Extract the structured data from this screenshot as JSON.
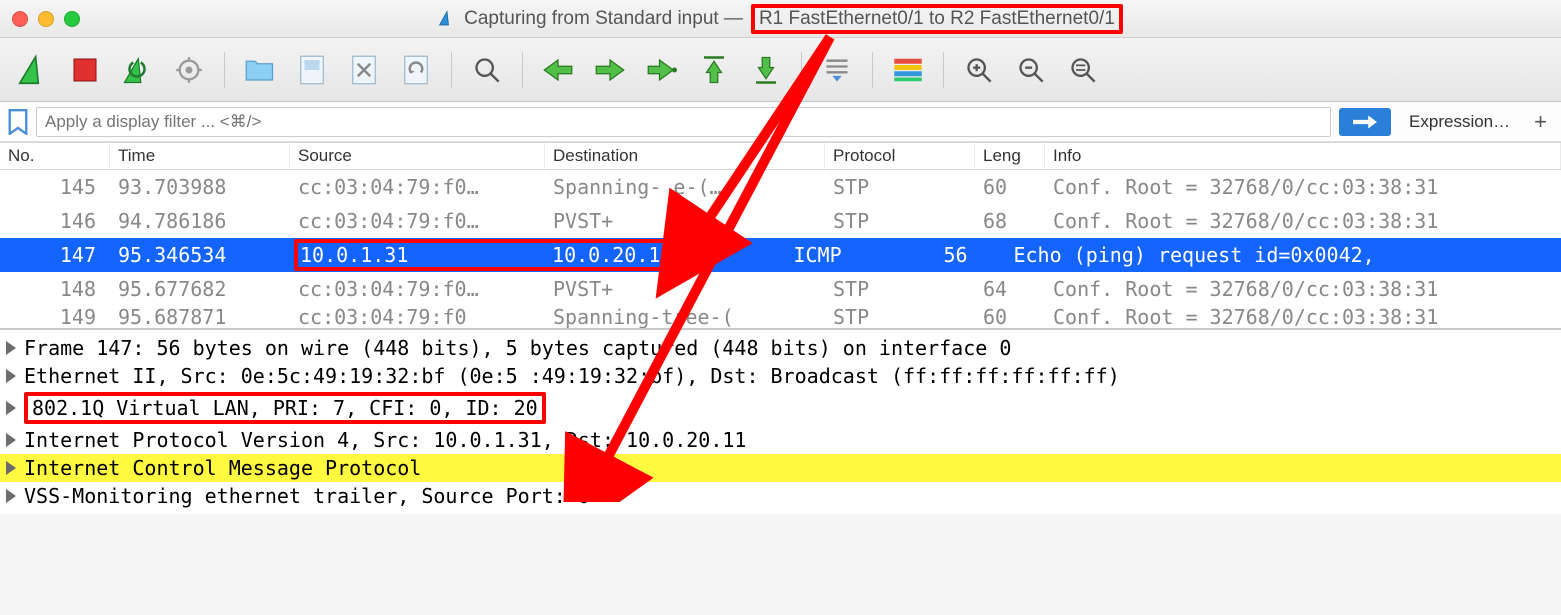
{
  "window": {
    "title_prefix": "Capturing from Standard input —",
    "title_highlight": "R1 FastEthernet0/1 to R2 FastEthernet0/1"
  },
  "filter": {
    "placeholder": "Apply a display filter ... <⌘/>",
    "expression_label": "Expression…"
  },
  "columns": {
    "no": "No.",
    "time": "Time",
    "source": "Source",
    "destination": "Destination",
    "protocol": "Protocol",
    "length": "Leng",
    "info": "Info"
  },
  "packets": [
    {
      "no": "145",
      "time": "93.703988",
      "src": "cc:03:04:79:f0…",
      "dst": "Spanning-    e-(…",
      "proto": "STP",
      "len": "60",
      "info": "Conf. Root = 32768/0/cc:03:38:31"
    },
    {
      "no": "146",
      "time": "94.786186",
      "src": "cc:03:04:79:f0…",
      "dst": "PVST+",
      "proto": "STP",
      "len": "68",
      "info": "Conf. Root = 32768/0/cc:03:38:31"
    },
    {
      "no": "147",
      "time": "95.346534",
      "src": "10.0.1.31",
      "dst": "10.0.20.11",
      "proto": "ICMP",
      "len": "56",
      "info": "Echo (ping) request  id=0x0042,"
    },
    {
      "no": "148",
      "time": "95.677682",
      "src": "cc:03:04:79:f0…",
      "dst": "PVST+",
      "proto": "STP",
      "len": "64",
      "info": "Conf. Root = 32768/0/cc:03:38:31"
    },
    {
      "no": "149",
      "time": "95.687871",
      "src": "cc:03:04:79:f0",
      "dst": "Spanning-tree-(",
      "proto": "STP",
      "len": "60",
      "info": "Conf. Root = 32768/0/cc:03:38:31"
    }
  ],
  "details": {
    "frame": "Frame 147: 56 bytes on wire (448 bits), 5  bytes captured (448 bits) on interface 0",
    "eth": "Ethernet II, Src: 0e:5c:49:19:32:bf (0e:5 :49:19:32:bf), Dst: Broadcast (ff:ff:ff:ff:ff:ff)",
    "vlan": "802.1Q Virtual LAN, PRI: 7, CFI: 0, ID: 20",
    "ipv4": "Internet Protocol Version 4, Src: 10.0.1.31, Dst: 10.0.20.11",
    "icmp": "Internet Control Message Protocol",
    "vss": "VSS-Monitoring ethernet trailer, Source Port: 0"
  },
  "icons": {
    "shark": "shark-fin-icon",
    "stop": "stop-capture-icon",
    "restart": "restart-capture-icon",
    "options": "capture-options-icon",
    "open": "open-file-icon",
    "save": "save-file-icon",
    "close": "close-file-icon",
    "reload": "reload-file-icon",
    "find": "find-packet-icon",
    "prev": "go-previous-icon",
    "next": "go-next-icon",
    "jump": "go-jump-icon",
    "first": "go-first-icon",
    "last": "go-last-icon",
    "autoscroll": "autoscroll-icon",
    "colorize": "colorize-icon",
    "zoomin": "zoom-in-icon",
    "zoomout": "zoom-out-icon",
    "zoomreset": "zoom-reset-icon"
  }
}
